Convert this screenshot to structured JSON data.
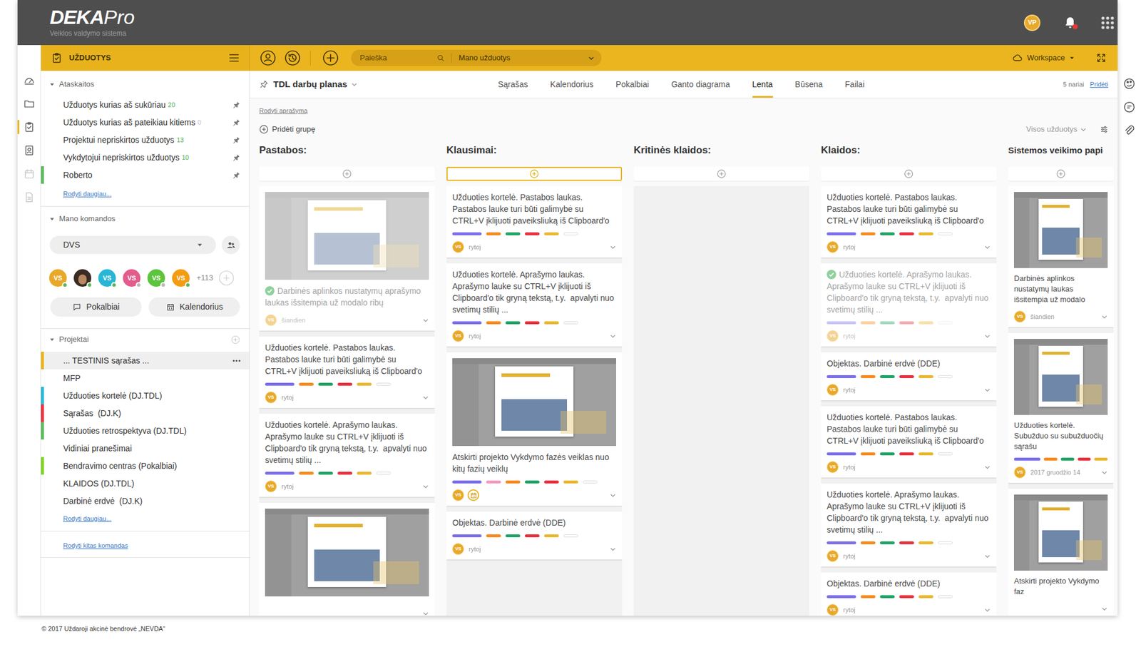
{
  "app": {
    "logo": "DEKA",
    "logo_accent": "Pro",
    "subtitle": "Veiklos valdymo sistema",
    "user": "VP",
    "has_unread": true
  },
  "rail": [
    {
      "kind": "gauge",
      "selected": false,
      "disabled": false
    },
    {
      "kind": "folder",
      "selected": false,
      "disabled": false
    },
    {
      "kind": "tasks",
      "selected": true,
      "disabled": false
    },
    {
      "kind": "contacts",
      "selected": false,
      "disabled": false
    },
    {
      "kind": "calendar",
      "selected": false,
      "disabled": true
    },
    {
      "kind": "document",
      "selected": false,
      "disabled": true
    }
  ],
  "right_rail": [
    {
      "kind": "palette"
    },
    {
      "kind": "chat"
    },
    {
      "kind": "clip"
    }
  ],
  "toolbar": {
    "section": "UŽDUOTYS",
    "search": {
      "placeholder": "Paieška"
    },
    "scope": "Mano užduotys",
    "workspace": "Workspace"
  },
  "sidebar": {
    "reports": {
      "title": "Ataskaitos",
      "expanded": true,
      "items": [
        {
          "label": "Užduotys kurias aš sukūriau",
          "count": "20",
          "count_muted": false,
          "color": null,
          "pinned": true
        },
        {
          "label": "Užduotys kurias aš pateikiau kitiems",
          "count": "0",
          "count_muted": true,
          "color": null,
          "pinned": true
        },
        {
          "label": "Projektui nepriskirtos užduotys",
          "count": "13",
          "count_muted": false,
          "color": null,
          "pinned": true
        },
        {
          "label": "Vykdytojui nepriskirtos užduotys",
          "count": "10",
          "count_muted": false,
          "color": null,
          "pinned": true
        },
        {
          "label": "Roberto",
          "count": "",
          "count_muted": false,
          "color": "#5cb85c",
          "pinned": true
        }
      ],
      "more": "Rodyti daugiau..."
    },
    "teams": {
      "title": "Mano komandos",
      "expanded": true,
      "team": "DVS",
      "members": [
        {
          "kind": "initials",
          "initials": "VS",
          "color": "#e8a92a",
          "online": true
        },
        {
          "kind": "photo",
          "initials": "",
          "color": "#3a2c22",
          "online": true
        },
        {
          "kind": "initials",
          "initials": "VS",
          "color": "#29b6d6",
          "online": true
        },
        {
          "kind": "initials",
          "initials": "VS",
          "color": "#e35d8c",
          "online": false
        },
        {
          "kind": "initials",
          "initials": "VS",
          "color": "#5cc43d",
          "online": false
        },
        {
          "kind": "initials",
          "initials": "VS",
          "color": "#f39c12",
          "online": true
        }
      ],
      "more_count": "+113",
      "buttons": [
        "Pokalbiai",
        "Kalendorius"
      ]
    },
    "projects": {
      "title": "Projektai",
      "expanded": true,
      "items": [
        {
          "label": "... TESTINIS sąrašas ...",
          "color": "#e8b41f",
          "selected": true,
          "menu": "•••"
        },
        {
          "label": "MFP",
          "color": null,
          "selected": false,
          "menu": ""
        },
        {
          "label": "Užduoties kortelė (DJ.TDL)",
          "color": "#29b6d6",
          "selected": false,
          "menu": ""
        },
        {
          "label": "Sąrašas  (DJ.K)",
          "color": "#e6323e",
          "selected": false,
          "menu": ""
        },
        {
          "label": "Užduoties retrospektyva (DJ.TDL)",
          "color": "#5cb85c",
          "selected": false,
          "menu": ""
        },
        {
          "label": "Vidiniai pranešimai",
          "color": null,
          "selected": false,
          "menu": ""
        },
        {
          "label": "Bendravimo centras (Pokalbiai)",
          "color": "#7ed321",
          "selected": false,
          "menu": ""
        },
        {
          "label": "KLAIDOS (DJ.TDL)",
          "color": null,
          "selected": false,
          "menu": ""
        },
        {
          "label": "Darbinė erdvė  (DJ.K)",
          "color": null,
          "selected": false,
          "menu": ""
        }
      ],
      "more": "Rodyti daugiau...",
      "other_teams": "Rodyti kitas komandas"
    }
  },
  "board": {
    "title": "TDL darbų planas",
    "tabs": [
      {
        "label": "Sąrašas",
        "selected": false
      },
      {
        "label": "Kalendorius",
        "selected": false
      },
      {
        "label": "Pokalbiai",
        "selected": false
      },
      {
        "label": "Ganto diagrama",
        "selected": false
      },
      {
        "label": "Lenta",
        "selected": true
      },
      {
        "label": "Būsena",
        "selected": false
      },
      {
        "label": "Failai",
        "selected": false
      }
    ],
    "members": "5 nariai",
    "add_member": "Pridėti",
    "show_description": "Rodyti aprašymą",
    "add_group": "Pridėti grupę",
    "filter": "Visos užduotys",
    "columns": [
      {
        "title": "Pastabos:",
        "add_focused": false,
        "cards": [
          {
            "kind": "image",
            "title": "Darbinės aplinkos nustatymų aprašymo laukas išsitempia už modalo ribų",
            "done": true,
            "labels": [],
            "assignee": "VS",
            "calendar_badge": false,
            "due": "šiandien"
          },
          {
            "kind": "text",
            "title": "Užduoties kortelė. Pastabos laukas. Pastabos lauke turi būti galimybė su CTRL+V įklijuoti paveiksliuką iš Clipboard'o",
            "done": false,
            "labels": [
              "#7b6fe8",
              "#f68b1f",
              "#21a366",
              "#e6323e",
              "#e9b82f",
              "#ffffff"
            ],
            "assignee": "VS",
            "calendar_badge": false,
            "due": "rytoj"
          },
          {
            "kind": "text",
            "title": "Užduoties kortelė. Aprašymo laukas. Aprašymo lauke su CTRL+V įklijuoti iš Clipboard'o tik gryną tekstą, t.y.  apvalyti nuo svetimų stilių ...",
            "done": false,
            "labels": [
              "#7b6fe8",
              "#f68b1f",
              "#21a366",
              "#e6323e",
              "#e9b82f",
              "#ffffff"
            ],
            "assignee": "VS",
            "calendar_badge": false,
            "due": "rytoj"
          },
          {
            "kind": "image",
            "title": "",
            "done": false,
            "labels": [],
            "assignee": "",
            "calendar_badge": false,
            "due": ""
          }
        ]
      },
      {
        "title": "Klausimai:",
        "add_focused": true,
        "cards": [
          {
            "kind": "text",
            "title": "Užduoties kortelė. Pastabos laukas. Pastabos lauke turi būti galimybė su CTRL+V įklijuoti paveiksliuką iš Clipboard'o",
            "done": false,
            "labels": [
              "#7b6fe8",
              "#f68b1f",
              "#21a366",
              "#e6323e",
              "#e9b82f",
              "#ffffff"
            ],
            "assignee": "VS",
            "calendar_badge": false,
            "due": "rytoj"
          },
          {
            "kind": "text",
            "title": "Užduoties kortelė. Aprašymo laukas. Aprašymo lauke su CTRL+V įklijuoti iš Clipboard'o tik gryną tekstą, t.y.  apvalyti nuo svetimų stilių ...",
            "done": false,
            "labels": [
              "#7b6fe8",
              "#f68b1f",
              "#21a366",
              "#e6323e",
              "#e9b82f",
              "#ffffff"
            ],
            "assignee": "VS",
            "calendar_badge": false,
            "due": "rytoj"
          },
          {
            "kind": "image",
            "title": "Atskirti projekto Vykdymo fazės veiklas nuo kitų fazių veiklų",
            "done": false,
            "labels": [
              "#7b6fe8",
              "#f29bc0",
              "#f68b1f",
              "#21a366",
              "#e6323e",
              "#e9b82f",
              "#ffffff"
            ],
            "assignee": "VS",
            "calendar_badge": true,
            "due": ""
          },
          {
            "kind": "text",
            "title": "Objektas. Darbinė erdvė (DDE)",
            "done": false,
            "labels": [
              "#7b6fe8",
              "#f68b1f",
              "#21a366",
              "#e6323e",
              "#e9b82f",
              "#ffffff"
            ],
            "assignee": "VS",
            "calendar_badge": false,
            "due": "rytoj"
          }
        ]
      },
      {
        "title": "Kritinės klaidos:",
        "add_focused": false,
        "cards": []
      },
      {
        "title": "Klaidos:",
        "add_focused": false,
        "cards": [
          {
            "kind": "text",
            "title": "Užduoties kortelė. Pastabos laukas. Pastabos lauke turi būti galimybė su CTRL+V įklijuoti paveiksliuką iš Clipboard'o",
            "done": false,
            "labels": [
              "#7b6fe8",
              "#f68b1f",
              "#21a366",
              "#e6323e",
              "#e9b82f",
              "#ffffff"
            ],
            "assignee": "VS",
            "calendar_badge": false,
            "due": "rytoj"
          },
          {
            "kind": "text",
            "title": "Užduoties kortelė. Aprašymo laukas. Aprašymo lauke su CTRL+V įklijuoti iš Clipboard'o tik gryną tekstą, t.y.  apvalyti nuo svetimų stilių ...",
            "done": true,
            "labels": [
              "#7b6fe8",
              "#f68b1f",
              "#21a366",
              "#e6323e",
              "#e9b82f",
              "#ffffff"
            ],
            "assignee": "VS",
            "calendar_badge": false,
            "due": "rytoj"
          },
          {
            "kind": "text",
            "title": "Objektas. Darbinė erdvė (DDE)",
            "done": false,
            "labels": [
              "#7b6fe8",
              "#f68b1f",
              "#21a366",
              "#e6323e",
              "#e9b82f",
              "#ffffff"
            ],
            "assignee": "VS",
            "calendar_badge": false,
            "due": "rytoj"
          },
          {
            "kind": "text",
            "title": "Užduoties kortelė. Pastabos laukas. Pastabos lauke turi būti galimybė su CTRL+V įklijuoti paveiksliuką iš Clipboard'o",
            "done": false,
            "labels": [
              "#7b6fe8",
              "#f68b1f",
              "#21a366",
              "#e6323e",
              "#e9b82f",
              "#ffffff"
            ],
            "assignee": "VS",
            "calendar_badge": false,
            "due": "rytoj"
          },
          {
            "kind": "text",
            "title": "Užduoties kortelė. Aprašymo laukas. Aprašymo lauke su CTRL+V įklijuoti iš Clipboard'o tik gryną tekstą, t.y.  apvalyti nuo svetimų stilių ...",
            "done": false,
            "labels": [
              "#7b6fe8",
              "#f68b1f",
              "#21a366",
              "#e6323e",
              "#e9b82f",
              "#ffffff"
            ],
            "assignee": "VS",
            "calendar_badge": false,
            "due": "rytoj"
          },
          {
            "kind": "text",
            "title": "Objektas. Darbinė erdvė (DDE)",
            "done": false,
            "labels": [
              "#7b6fe8",
              "#f68b1f",
              "#21a366",
              "#e6323e",
              "#e9b82f",
              "#ffffff"
            ],
            "assignee": "VS",
            "calendar_badge": false,
            "due": "rytoj"
          }
        ]
      },
      {
        "title": "Sistemos veikimo papi",
        "add_focused": false,
        "cards": [
          {
            "kind": "image",
            "title": "Darbinės aplinkos nustatymų laukas išsitempia už modalo",
            "done": false,
            "labels": [],
            "assignee": "VS",
            "calendar_badge": false,
            "due": "šiandien"
          },
          {
            "kind": "image",
            "title": "Užduoties kortelė. Subužduo su subužduočių sąrašu",
            "done": false,
            "labels": [
              "#7b6fe8",
              "#f68b1f",
              "#21a366",
              "#e6323e",
              "#e9b82f"
            ],
            "assignee": "VS",
            "calendar_badge": false,
            "due": "2017 gruodžio 14"
          },
          {
            "kind": "image",
            "title": "Atskirti projekto Vykdymo faz",
            "done": false,
            "labels": [],
            "assignee": "",
            "calendar_badge": false,
            "due": ""
          }
        ]
      }
    ]
  },
  "footer": "© 2017 Uždaroji akcinė bendrovė „NEVDA“"
}
